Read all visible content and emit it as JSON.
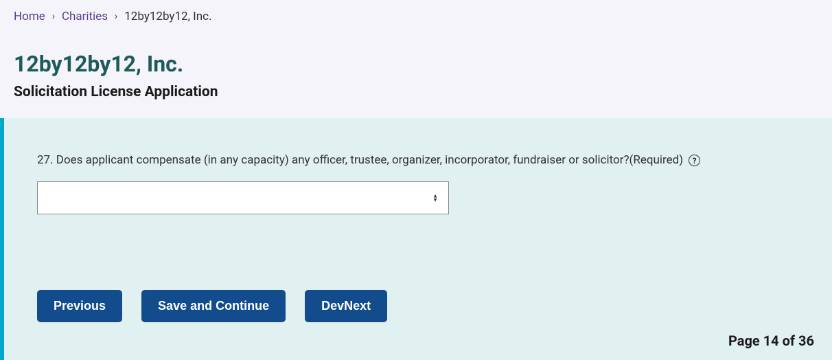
{
  "breadcrumb": {
    "home": "Home",
    "charities": "Charities",
    "current": "12by12by12, Inc."
  },
  "header": {
    "title": "12by12by12, Inc.",
    "subtitle": "Solicitation License Application"
  },
  "form": {
    "question": "27. Does applicant compensate (in any capacity) any officer, trustee, organizer, incorporator, fundraiser or solicitor?(Required)",
    "select_value": ""
  },
  "buttons": {
    "previous": "Previous",
    "save_continue": "Save and Continue",
    "dev_next": "DevNext"
  },
  "pagination": {
    "label": "Page 14 of 36"
  }
}
